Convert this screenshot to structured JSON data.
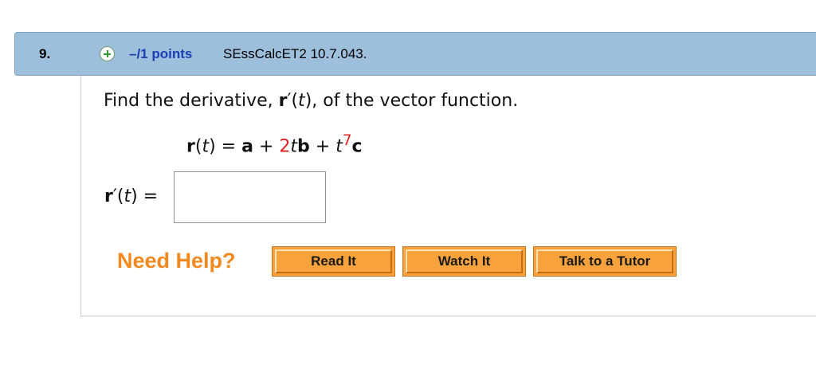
{
  "question": {
    "number": "9.",
    "points": "–/1 points",
    "id": "SEssCalcET2 10.7.043."
  },
  "prompt": {
    "before": "Find the derivative, ",
    "r_symbol": "r",
    "prime_t": "′(",
    "t": "t",
    "after": "), of the vector function."
  },
  "equation": {
    "r": "r",
    "open": "(",
    "t": "t",
    "close_eq": ") = ",
    "a": "a",
    "plus1": " + ",
    "coef": "2",
    "t2": "t",
    "b": "b",
    "plus2": " + ",
    "t3": "t",
    "exp": "7",
    "c": "c"
  },
  "answer": {
    "r": "r",
    "prime_open": "′(",
    "t": "t",
    "close_eq": ") =",
    "value": ""
  },
  "help": {
    "label": "Need Help?",
    "buttons": [
      "Read It",
      "Watch It",
      "Talk to a Tutor"
    ]
  },
  "colors": {
    "header_bg": "#9dbfdc",
    "points_text": "#1a3fb5",
    "need_help": "#f0891e",
    "button_bg": "#f7a23c",
    "highlight_red": "#e0211e"
  }
}
